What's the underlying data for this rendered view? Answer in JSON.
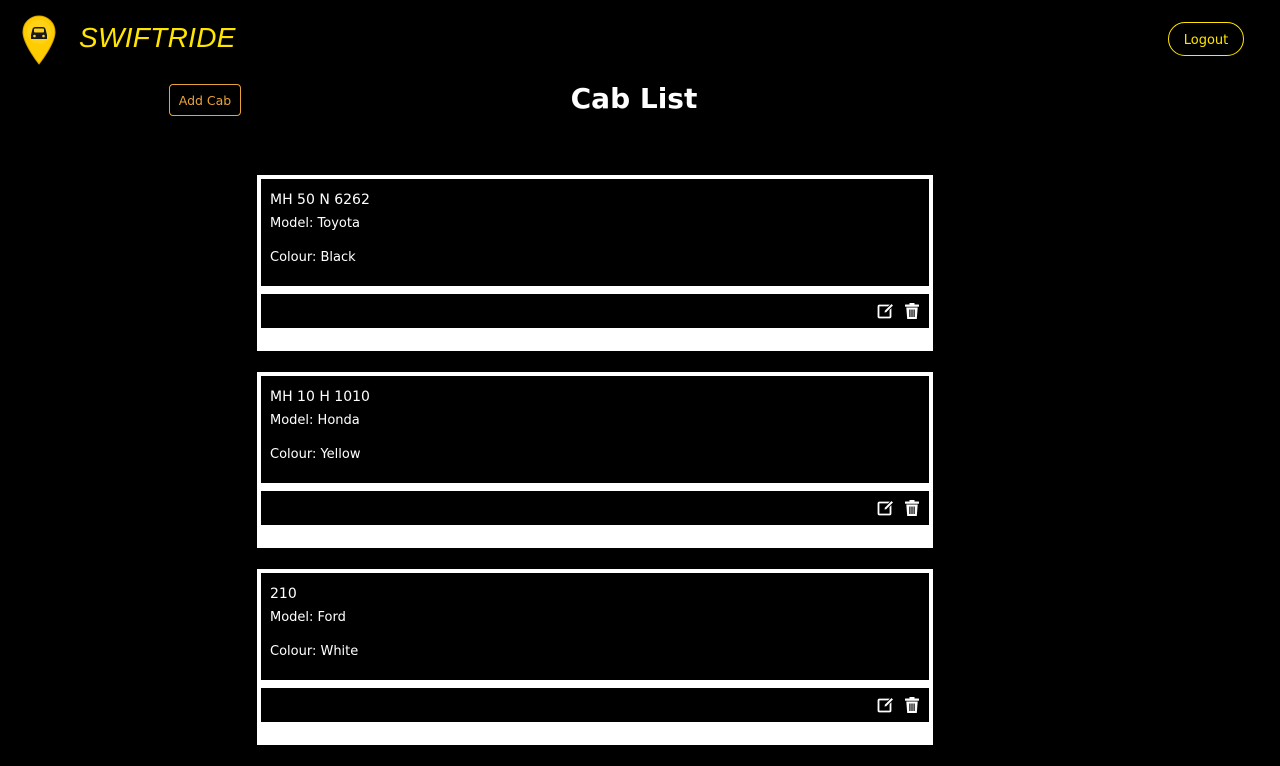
{
  "header": {
    "brand": "SWIFTRIDE",
    "logo_icon": "map-pin-car-icon",
    "logout_label": "Logout"
  },
  "toolbar": {
    "add_cab_label": "Add Cab"
  },
  "main": {
    "title": "Cab List",
    "cabs": [
      {
        "number": "MH 50 N 6262",
        "model": "Model: Toyota",
        "colour": "Colour: Black"
      },
      {
        "number": "MH 10 H 1010",
        "model": "Model: Honda",
        "colour": "Colour: Yellow"
      },
      {
        "number": "210",
        "model": "Model: Ford",
        "colour": "Colour: White"
      }
    ],
    "action_icons": [
      "edit-icon",
      "trash-icon"
    ]
  },
  "colors": {
    "accent": "#ffe500",
    "button_outline": "#e8a33a",
    "background": "#000000",
    "card_border": "#ffffff"
  }
}
